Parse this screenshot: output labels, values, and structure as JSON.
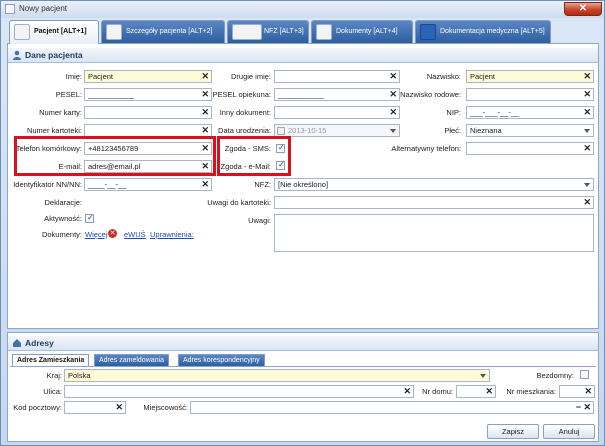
{
  "window": {
    "title": "Nowy pacjent"
  },
  "tabs": [
    {
      "label": "Pacjent [ALT+1]",
      "icon": "patient-icon"
    },
    {
      "label": "Szczegóły pacjenta [ALT+2]",
      "icon": "details-search-icon"
    },
    {
      "label": "NFZ [ALT+3]",
      "icon": "nfz-icon"
    },
    {
      "label": "Dokumenty [ALT+4]",
      "icon": "document-icon"
    },
    {
      "label": "Dokumentacja medyczna [ALT+5]",
      "icon": "medical-caduceus-icon"
    }
  ],
  "section": {
    "title": "Dane pacjenta"
  },
  "form": {
    "imie_label": "Imię:",
    "imie_value": "Pacjent",
    "pesel_label": "PESEL:",
    "pesel_value": "___________",
    "nr_karty_label": "Numer karty:",
    "nr_kartoteki_label": "Numer kartoteki:",
    "telefon_label": "Telefon komórkowy:",
    "telefon_value": "+48123456789",
    "email_label": "E-mail:",
    "email_value": "adres@email.pl",
    "identyfikator_label": "Identyfikator NN/NN:",
    "identyfikator_value": "____-__-__",
    "deklaracje_label": "Deklaracje:",
    "aktywnosc_label": "Aktywność:",
    "dokumenty_label": "Dokumenty:",
    "link_wiecej": "Więcej",
    "link_ewus": "eWUŚ",
    "link_uprawnienia": "Uprawnienia:",
    "drugie_imie_label": "Drugie imię:",
    "pesel_opiekuna_label": "PESEL opiekuna:",
    "pesel_opiekuna_value": "___________",
    "inny_dokument_label": "Inny dokument:",
    "data_urodzenia_label": "Data urodzenia:",
    "data_urodzenia_value": "2013-10-15",
    "zgoda_sms_label": "Zgoda - SMS:",
    "zgoda_email_label": "Zgoda - e-Mail:",
    "nfz_label": "NFZ:",
    "nfz_value": "[Nie określono]",
    "uwagi_kartoteki_label": "Uwagi do kartoteki:",
    "uwagi_label": "Uwagi:",
    "nazwisko_label": "Nazwisko:",
    "nazwisko_value": "Pacjent",
    "nazwisko_rodowe_label": "Nazwisko rodowe:",
    "nip_label": "NIP:",
    "nip_value": "___-___-__-__",
    "plec_label": "Płeć:",
    "plec_value": "Nieznana",
    "alt_telefon_label": "Alternatywny telefon:"
  },
  "address": {
    "title": "Adresy",
    "tabs": [
      "Adres Zamieszkania",
      "Adres zameldowania",
      "Adres korespondencyjny"
    ],
    "kraj_label": "Kraj:",
    "kraj_value": "Polska",
    "bezdomny_label": "Bezdomny:",
    "ulica_label": "Ulica:",
    "nr_domu_label": "Nr domu:",
    "nr_mieszkania_label": "Nr mieszkania:",
    "kod_label": "Kod pocztowy:",
    "miejscowosc_label": "Miejscowość:"
  },
  "buttons": {
    "save": "Zapisz",
    "cancel": "Anuluj"
  },
  "colors": {
    "highlight": "#d9101e",
    "tab_active": "#ffffff",
    "tab_inactive": "#2d5e9f",
    "required_field": "#fdfcd7"
  }
}
